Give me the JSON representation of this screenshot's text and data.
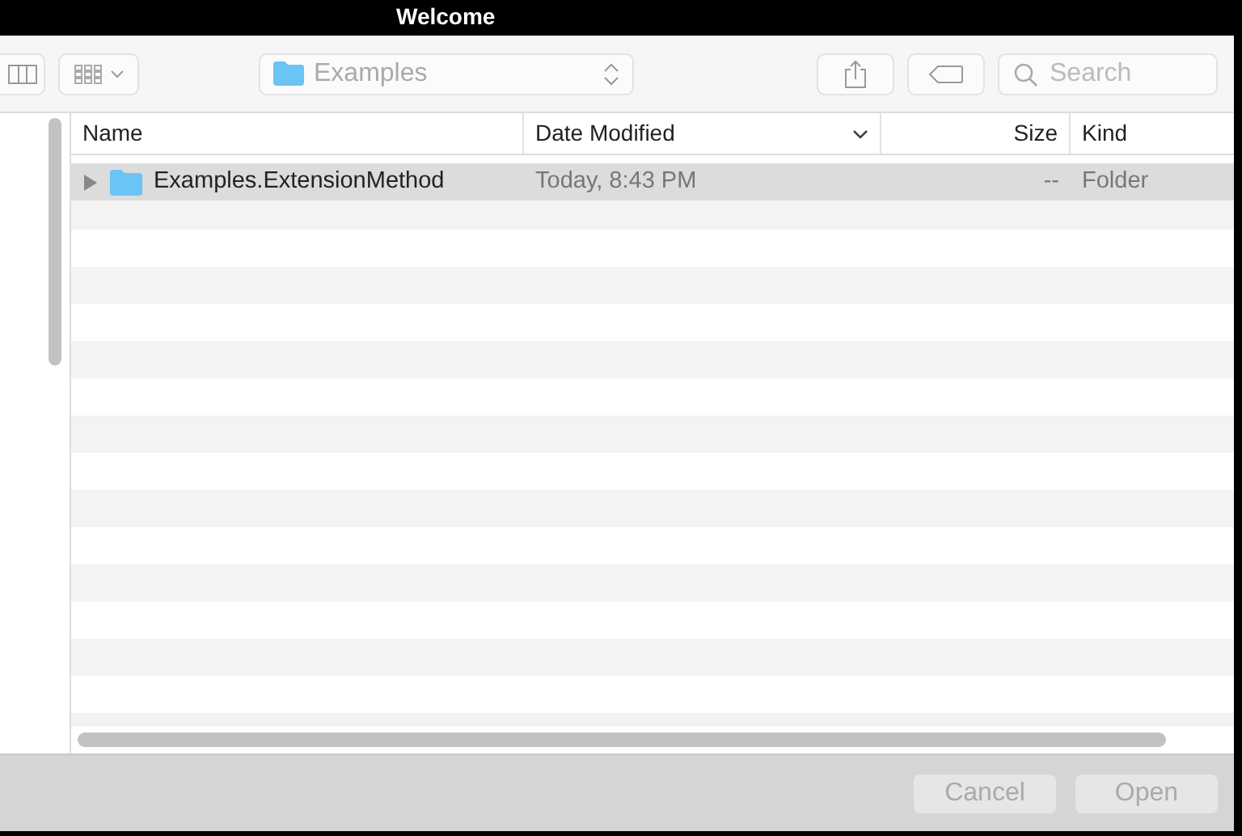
{
  "window": {
    "title": "Welcome"
  },
  "toolbar": {
    "location": "Examples",
    "search": {
      "placeholder": "Search"
    }
  },
  "table": {
    "columns": [
      {
        "label": "Name",
        "sorted": false
      },
      {
        "label": "Date Modified",
        "sorted": true
      },
      {
        "label": "Size",
        "sorted": false
      },
      {
        "label": "Kind",
        "sorted": false
      }
    ],
    "rows": [
      {
        "name": "Examples.ExtensionMethod",
        "date_modified": "Today, 8:43 PM",
        "size": "--",
        "kind": "Folder",
        "selected": true,
        "expanded": false
      }
    ]
  },
  "buttons": [
    {
      "label": "Cancel",
      "disabled": true
    },
    {
      "label": "Open",
      "disabled": true
    }
  ]
}
